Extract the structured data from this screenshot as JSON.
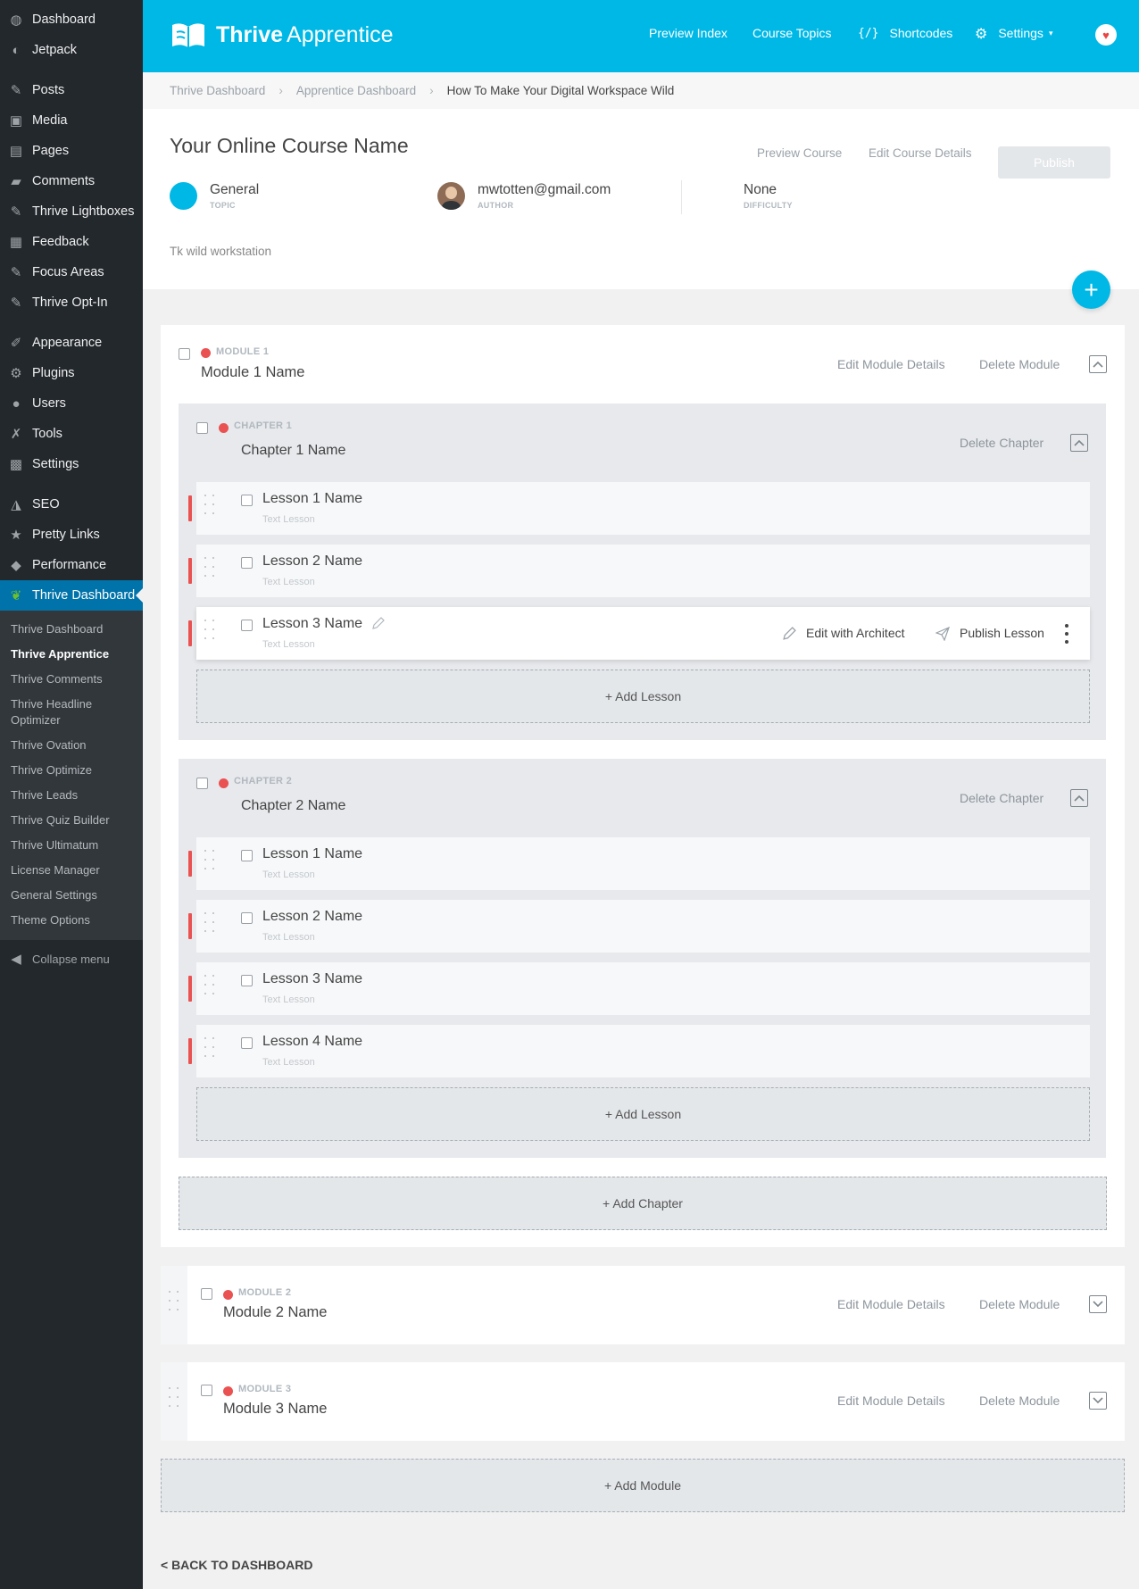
{
  "sidebar": {
    "items": [
      {
        "label": "Dashboard",
        "icon": "dashboard-icon",
        "glyph": "◍"
      },
      {
        "label": "Jetpack",
        "icon": "jetpack-icon",
        "glyph": "◐"
      },
      {
        "label": "Posts",
        "icon": "pin-icon",
        "glyph": "✎"
      },
      {
        "label": "Media",
        "icon": "media-icon",
        "glyph": "▣"
      },
      {
        "label": "Pages",
        "icon": "pages-icon",
        "glyph": "▤"
      },
      {
        "label": "Comments",
        "icon": "comment-icon",
        "glyph": "▰"
      },
      {
        "label": "Thrive Lightboxes",
        "icon": "pin-icon",
        "glyph": "✎"
      },
      {
        "label": "Feedback",
        "icon": "feedback-icon",
        "glyph": "▦"
      },
      {
        "label": "Focus Areas",
        "icon": "pin-icon",
        "glyph": "✎"
      },
      {
        "label": "Thrive Opt-In",
        "icon": "pin-icon",
        "glyph": "✎"
      },
      {
        "label": "Appearance",
        "icon": "brush-icon",
        "glyph": "✐"
      },
      {
        "label": "Plugins",
        "icon": "plugin-icon",
        "glyph": "⚙"
      },
      {
        "label": "Users",
        "icon": "user-icon",
        "glyph": "●"
      },
      {
        "label": "Tools",
        "icon": "wrench-icon",
        "glyph": "✗"
      },
      {
        "label": "Settings",
        "icon": "settings-icon",
        "glyph": "▩"
      },
      {
        "label": "SEO",
        "icon": "seo-icon",
        "glyph": "◮"
      },
      {
        "label": "Pretty Links",
        "icon": "star-icon",
        "glyph": "★"
      },
      {
        "label": "Performance",
        "icon": "performance-icon",
        "glyph": "◆"
      },
      {
        "label": "Thrive Dashboard",
        "icon": "leaf-icon",
        "glyph": "❦"
      }
    ],
    "submenu": [
      "Thrive Dashboard",
      "Thrive Apprentice",
      "Thrive Comments",
      "Thrive Headline Optimizer",
      "Thrive Ovation",
      "Thrive Optimize",
      "Thrive Leads",
      "Thrive Quiz Builder",
      "Thrive Ultimatum",
      "License Manager",
      "General Settings",
      "Theme Options"
    ],
    "collapse": "Collapse menu"
  },
  "header": {
    "logo_bold": "Thrive",
    "logo_light": "Apprentice",
    "nav": {
      "preview_index": "Preview Index",
      "course_topics": "Course Topics",
      "shortcodes_icon": "{/}",
      "shortcodes": "Shortcodes",
      "settings": "Settings"
    }
  },
  "breadcrumb": [
    "Thrive Dashboard",
    "Apprentice Dashboard",
    "How To Make Your Digital Workspace Wild"
  ],
  "course": {
    "title": "Your Online Course Name",
    "preview": "Preview Course",
    "edit": "Edit Course Details",
    "publish": "Publish",
    "topic": {
      "value": "General",
      "label": "TOPIC"
    },
    "author": {
      "value": "mwtotten@gmail.com",
      "label": "AUTHOR"
    },
    "difficulty": {
      "value": "None",
      "label": "DIFFICULTY"
    },
    "description": "Tk wild workstation"
  },
  "module1": {
    "tag": "MODULE 1",
    "name": "Module 1 Name",
    "edit": "Edit Module Details",
    "delete": "Delete Module",
    "chapter1": {
      "tag": "CHAPTER 1",
      "name": "Chapter 1 Name",
      "delete": "Delete Chapter",
      "lessons": [
        {
          "name": "Lesson 1 Name",
          "type": "Text Lesson"
        },
        {
          "name": "Lesson 2 Name",
          "type": "Text Lesson"
        },
        {
          "name": "Lesson 3 Name",
          "type": "Text Lesson"
        }
      ],
      "edit_architect": "Edit with Architect",
      "publish_lesson": "Publish Lesson",
      "add_lesson": "+ Add Lesson"
    },
    "chapter2": {
      "tag": "CHAPTER 2",
      "name": "Chapter 2 Name",
      "delete": "Delete Chapter",
      "lessons": [
        {
          "name": "Lesson 1 Name",
          "type": "Text Lesson"
        },
        {
          "name": "Lesson 2 Name",
          "type": "Text Lesson"
        },
        {
          "name": "Lesson 3 Name",
          "type": "Text Lesson"
        },
        {
          "name": "Lesson 4 Name",
          "type": "Text Lesson"
        }
      ],
      "add_lesson": "+ Add Lesson"
    },
    "add_chapter": "+ Add Chapter"
  },
  "module2": {
    "tag": "MODULE 2",
    "name": "Module 2 Name",
    "edit": "Edit Module Details",
    "delete": "Delete Module"
  },
  "module3": {
    "tag": "MODULE 3",
    "name": "Module 3 Name",
    "edit": "Edit Module Details",
    "delete": "Delete Module"
  },
  "add_module": "+ Add Module",
  "back": "< BACK TO DASHBOARD",
  "colors": {
    "brand": "#00b8e6",
    "status_dot": "#ea5252",
    "sidebar": "#23282d",
    "active": "#0073aa"
  }
}
